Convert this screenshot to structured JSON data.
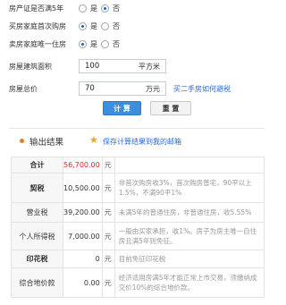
{
  "form": {
    "q1": {
      "label": "房产证是否满5年",
      "options": [
        "是",
        "否"
      ],
      "selected": 1
    },
    "q2": {
      "label": "买房家庭首次购房",
      "options": [
        "是",
        "否"
      ],
      "selected": 0
    },
    "q3": {
      "label": "卖房家庭唯一住房",
      "options": [
        "是",
        "否"
      ],
      "selected": 0
    },
    "area": {
      "label": "房屋建筑面积",
      "value": "100",
      "unit": "平方米"
    },
    "price": {
      "label": "房屋总价",
      "value": "70",
      "unit": "万元",
      "link": "买二手房如何避税"
    },
    "buttons": {
      "calc": "计 算",
      "reset": "重 置"
    }
  },
  "results": {
    "title": "输出结果",
    "save_link": "保存计算结果到我的邮箱",
    "rows": [
      {
        "name": "合计",
        "value": "56,700.00",
        "unit": "元",
        "note": "",
        "highlight": true
      },
      {
        "name": "契税",
        "value": "10,500.00",
        "unit": "元",
        "note": "非首次购房收3%，首次购房普宅，90平以上1.5%，不满90平1%",
        "highlight": false
      },
      {
        "name": "营业税",
        "value": "39,200.00",
        "unit": "元",
        "note": "未满5年的普通住房，非普通住房，收5.55%",
        "highlight": false
      },
      {
        "name": "个人所得税",
        "value": "7,000.00",
        "unit": "元",
        "note": "一般由买家承担，收1%。房子为房主唯一自住房且满5年则免征。",
        "highlight": false
      },
      {
        "name": "印花税",
        "value": "0",
        "unit": "元",
        "note": "目前免征印花税",
        "highlight": false
      },
      {
        "name": "综合地价款",
        "value": "0.00",
        "unit": "元",
        "note": "经济适用房满5年才能正常上市交易，须缴纳成交价10%的综合地价款。",
        "highlight": false
      }
    ]
  },
  "colors": {
    "accent": "#3b8fdc",
    "link": "#2a6ad4",
    "total_value": "#e52020",
    "bullet": "#ee7d1b"
  },
  "icons": {
    "title_bullet": "orange-dot-icon",
    "save": "star-icon"
  }
}
